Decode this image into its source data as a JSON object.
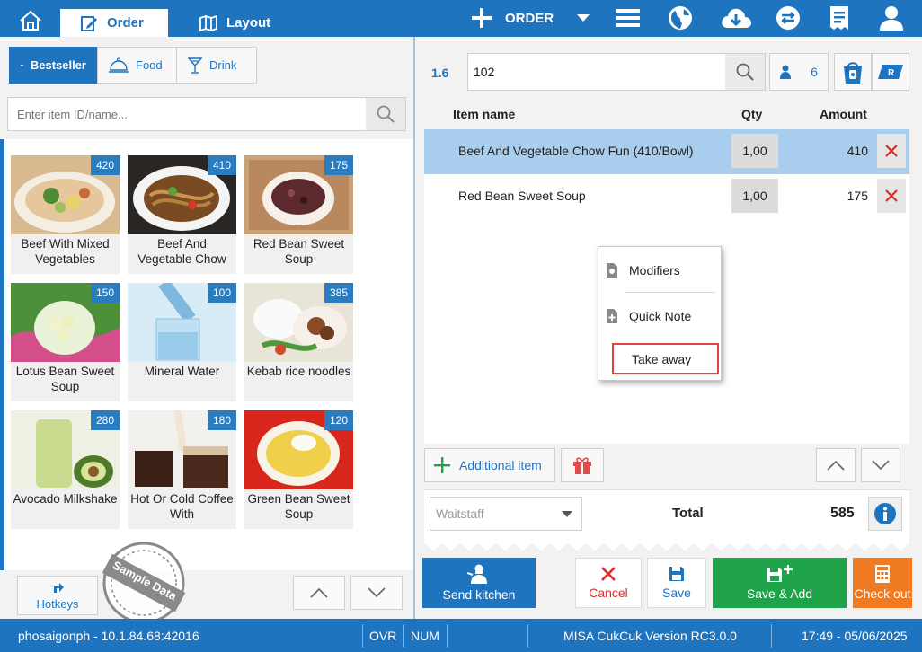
{
  "topbar": {
    "tab_order": "Order",
    "tab_layout": "Layout",
    "order_mode": "ORDER"
  },
  "categories": [
    {
      "label": "Bestseller",
      "active": true
    },
    {
      "label": "Food",
      "active": false
    },
    {
      "label": "Drink",
      "active": false
    }
  ],
  "search": {
    "placeholder": "Enter item ID/name..."
  },
  "menu_items": [
    {
      "name": "Beef With Mixed Vegetables",
      "price": "420"
    },
    {
      "name": "Beef And Vegetable Chow",
      "price": "410"
    },
    {
      "name": "Red Bean Sweet Soup",
      "price": "175"
    },
    {
      "name": "Lotus Bean Sweet Soup",
      "price": "150"
    },
    {
      "name": "Mineral Water",
      "price": "100"
    },
    {
      "name": "Kebab rice noodles",
      "price": "385"
    },
    {
      "name": "Avocado Milkshake",
      "price": "280"
    },
    {
      "name": "Hot Or Cold Coffee With",
      "price": "180"
    },
    {
      "name": "Green Bean Sweet Soup",
      "price": "120"
    }
  ],
  "left_bottom": {
    "hotkeys": "Hotkeys",
    "stamp": "Sample Data"
  },
  "order": {
    "table_no": "1.6",
    "ticket_no": "102",
    "guests": "6",
    "col_item": "Item name",
    "col_qty": "Qty",
    "col_amount": "Amount",
    "rows": [
      {
        "name": "Beef And Vegetable Chow Fun (410/Bowl)",
        "qty": "1,00",
        "amount": "410"
      },
      {
        "name": "Red Bean Sweet Soup",
        "qty": "1,00",
        "amount": "175"
      }
    ],
    "context_menu": {
      "modifiers": "Modifiers",
      "quick_note": "Quick Note",
      "take_away": "Take away"
    },
    "additional_item": "Additional item",
    "waitstaff_placeholder": "Waitstaff",
    "total_label": "Total",
    "total_value": "585"
  },
  "actions": {
    "send_kitchen": "Send kitchen",
    "cancel": "Cancel",
    "save": "Save",
    "save_add": "Save & Add",
    "check_out": "Check out"
  },
  "status": {
    "server": "phosaigonph - 10.1.84.68:42016",
    "ovr": "OVR",
    "num": "NUM",
    "version": "MISA CukCuk Version RC3.0.0",
    "datetime": "17:49 - 05/06/2025"
  },
  "colors": {
    "primary": "#1f74c0",
    "save_add": "#1fa34a",
    "check_out": "#ef7a22",
    "danger": "#e02b2b"
  }
}
